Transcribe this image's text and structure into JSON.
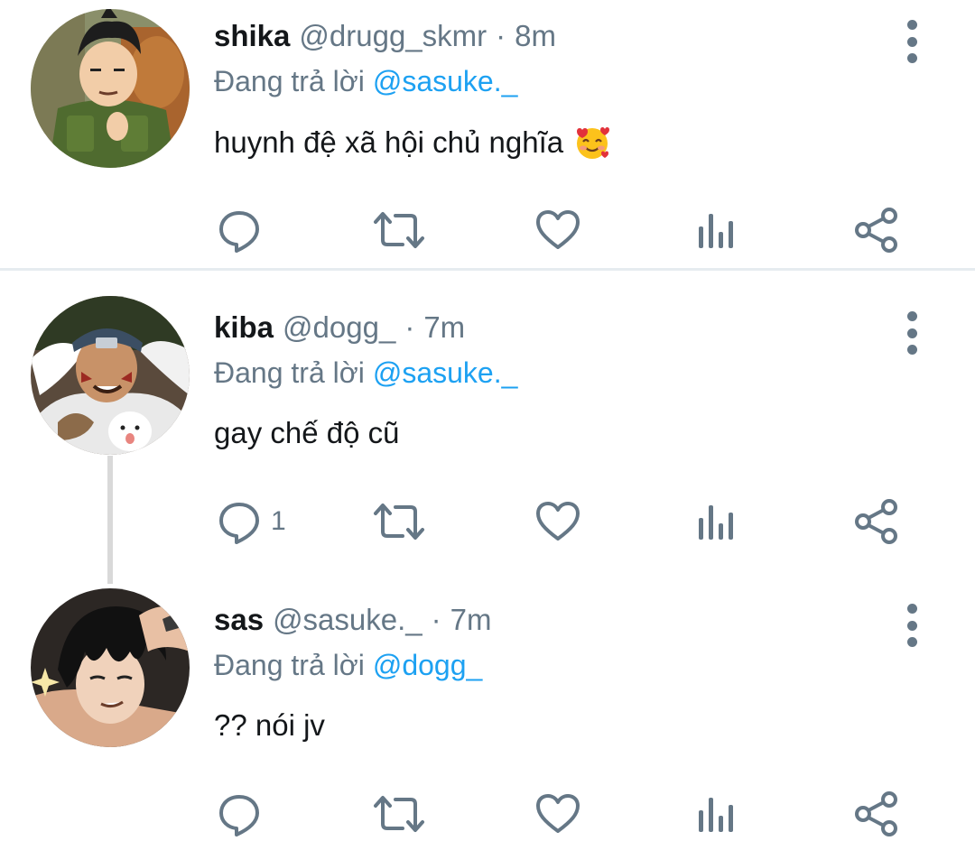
{
  "colors": {
    "text": "#14171a",
    "secondary": "#657786",
    "accent": "#1da1f2",
    "divider": "#e6ecf0",
    "thread_line": "#d9d9d9"
  },
  "tweets": [
    {
      "name": "shika",
      "handle": "@drugg_skmr",
      "separator": "·",
      "time": "8m",
      "reply_prefix": "Đang trả lời",
      "reply_to": "@sasuke._",
      "text": "huynh đệ xã hội chủ nghĩa",
      "emoji": "smiling-face-with-hearts",
      "reply_count": "",
      "avatar": "shikamaru-avatar"
    },
    {
      "name": "kiba",
      "handle": "@dogg_",
      "separator": "·",
      "time": "7m",
      "reply_prefix": "Đang trả lời",
      "reply_to": "@sasuke._",
      "text": "gay chế độ cũ",
      "reply_count": "1",
      "avatar": "kiba-avatar"
    },
    {
      "name": "sas",
      "handle": "@sasuke._",
      "separator": "·",
      "time": "7m",
      "reply_prefix": "Đang trả lời",
      "reply_to": "@dogg_",
      "text": "?? nói jv",
      "reply_count": "",
      "avatar": "sasuke-avatar"
    }
  ],
  "action_icons": [
    "reply-icon",
    "retweet-icon",
    "like-icon",
    "analytics-icon",
    "share-icon"
  ]
}
